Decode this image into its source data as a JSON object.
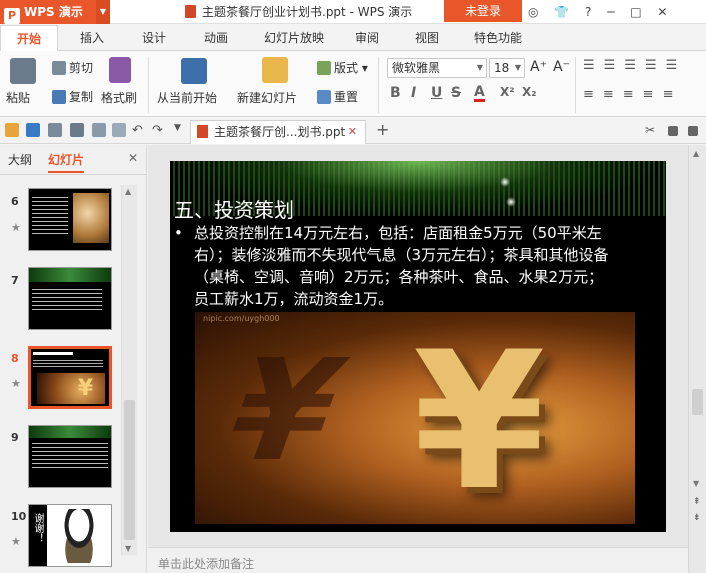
{
  "app": {
    "logo_text": "WPS 演示",
    "window_title": "主题茶餐厅创业计划书.ppt - WPS 演示",
    "login_label": "未登录",
    "title_icons": "◎ 👕 ? ─ □ ✕"
  },
  "menu": [
    "开始",
    "插入",
    "设计",
    "动画",
    "幻灯片放映",
    "审阅",
    "视图",
    "特色功能"
  ],
  "ribbon": {
    "paste": "粘贴",
    "cut": "剪切",
    "copy": "复制",
    "format_painter": "格式刷",
    "from_current": "从当前开始",
    "new_slide": "新建幻灯片",
    "layout": "版式",
    "reset": "重置",
    "font_name": "微软雅黑",
    "font_size": "18",
    "grow": "A",
    "shrink": "A",
    "bold": "B",
    "italic": "I",
    "underline": "U",
    "strike": "S",
    "fontcolor": "A",
    "superscript": "X²",
    "subscript": "X₂"
  },
  "doc_tab": {
    "title": "主题茶餐厅创...划书.ppt",
    "add": "+"
  },
  "sidepanel": {
    "tab_outline": "大纲",
    "tab_slides": "幻灯片",
    "close": "✕",
    "star": "★",
    "slides": [
      {
        "num": "6",
        "selected": false
      },
      {
        "num": "7",
        "selected": false
      },
      {
        "num": "8",
        "selected": true
      },
      {
        "num": "9",
        "selected": false
      },
      {
        "num": "10",
        "selected": false,
        "text": "谢谢！"
      }
    ]
  },
  "slide": {
    "title": "五、投资策划",
    "bullet": "•",
    "body": "总投资控制在14万元左右，包括：店面租金5万元（50平米左右）；装修淡雅而不失现代气息（3万元左右）；茶具和其他设备（桌椅、空调、音响）2万元；各种茶叶、食品、水果2万元；员工薪水1万，流动资金1万。",
    "watermark": "nipic.com/uygh000",
    "symbol": "¥"
  },
  "notes_placeholder": "单击此处添加备注",
  "colors": {
    "accent": "#e8562a",
    "slide_bg": "#000000"
  }
}
